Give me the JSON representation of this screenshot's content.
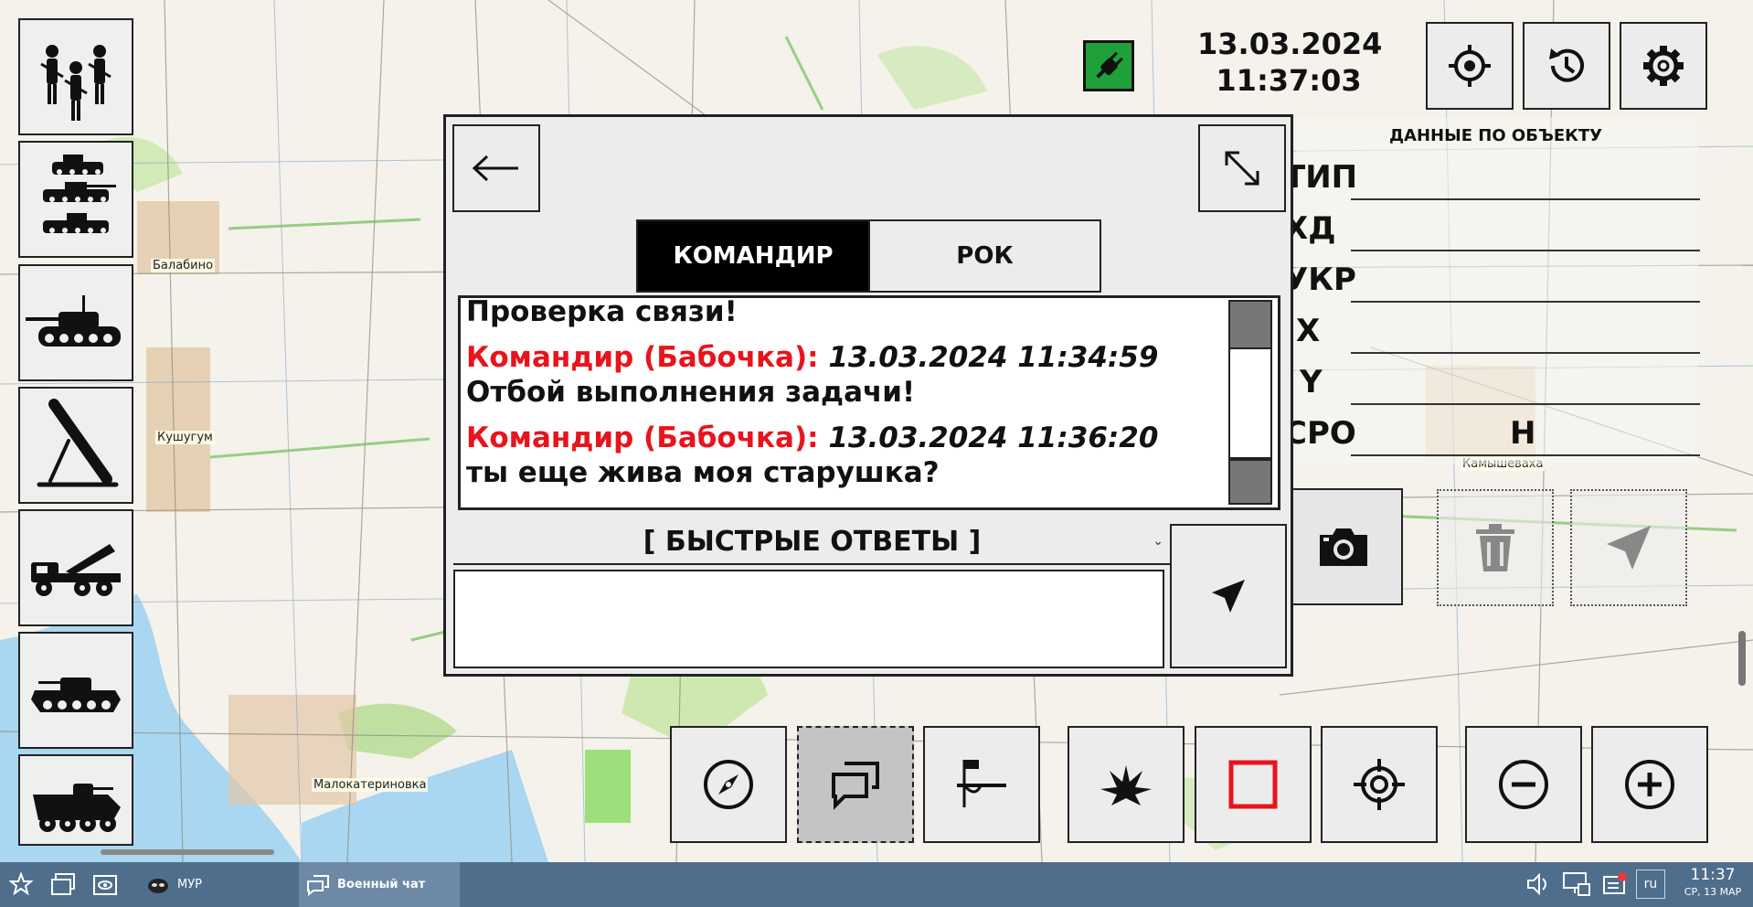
{
  "map": {
    "places": [
      "Балабино",
      "Кушугум",
      "Малокатериновка",
      "Камышеваха"
    ]
  },
  "clock": {
    "date": "13.03.2024",
    "time": "11:37:03"
  },
  "object_panel": {
    "title": "ДАННЫЕ ПО ОБЪЕКТУ",
    "fields": [
      {
        "label": "ТИП",
        "value": ""
      },
      {
        "label": "ХД",
        "value": ""
      },
      {
        "label": "УКР",
        "value": ""
      },
      {
        "label": "X",
        "value": ""
      },
      {
        "label": "Y",
        "value": ""
      },
      {
        "label": "СРО",
        "value": "Н"
      }
    ]
  },
  "chat": {
    "tabs": [
      {
        "label": "КОМАНДИР",
        "active": true
      },
      {
        "label": "РОК",
        "active": false
      }
    ],
    "messages": [
      {
        "sender": "",
        "time": "",
        "text": "Проверка связи!"
      },
      {
        "sender": "Командир (Бабочка):",
        "time": "13.03.2024 11:34:59",
        "text": "Отбой выполнения задачи!"
      },
      {
        "sender": "Командир (Бабочка):",
        "time": "13.03.2024 11:36:20",
        "text": "ты еще жива моя старушка?"
      }
    ],
    "quick_replies_label": "[ БЫСТРЫЕ ОТВЕТЫ ]",
    "input_value": "",
    "scroll_fraction": 0.9
  },
  "left_toolbar": [
    "infantry-icon",
    "armor-group-icon",
    "tank-icon",
    "mortar-icon",
    "rocket-launcher-icon",
    "ifv-icon",
    "apc-icon"
  ],
  "bottom_toolbar": [
    "compass-icon",
    "chat-icon",
    "flag-line-icon",
    "explosion-icon",
    "square-icon",
    "target-icon",
    "zoom-out-icon",
    "zoom-in-icon"
  ],
  "taskbar": {
    "apps": [
      {
        "label": "МУР",
        "active": false
      },
      {
        "label": "Военный чат",
        "active": true
      }
    ],
    "lang": "ru",
    "time": "11:37",
    "date": "СР, 13 МАР"
  },
  "colors": {
    "sender": "#e8141c",
    "active_tab_bg": "#000000",
    "taskbar": "#4f6e8c",
    "plug_bg": "#1fa03a",
    "rect_tool": "#e8141c"
  }
}
